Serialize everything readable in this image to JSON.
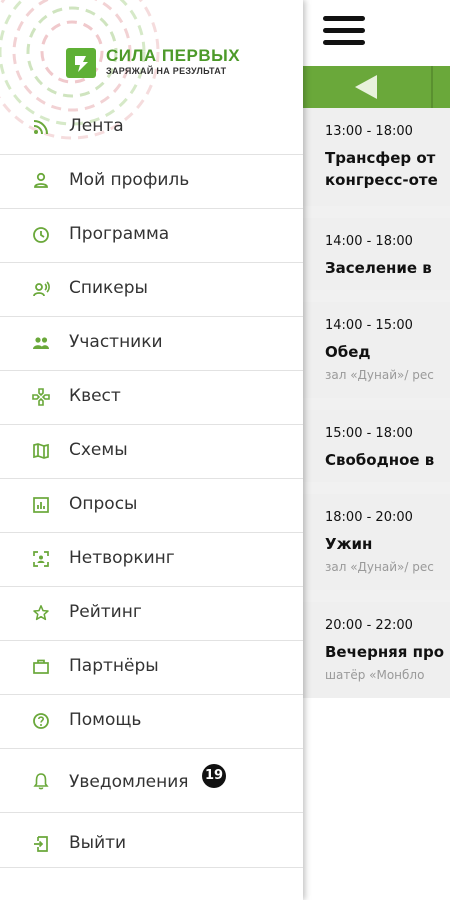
{
  "brand": {
    "title": "СИЛА ПЕРВЫХ",
    "subtitle": "ЗАРЯЖАЙ НА РЕЗУЛЬТАТ",
    "accent": "#6aa83a",
    "icon": "brand-logo-icon"
  },
  "menu": [
    {
      "label": "Лента",
      "icon": "rss-icon"
    },
    {
      "label": "Мой профиль",
      "icon": "person-icon"
    },
    {
      "label": "Программа",
      "icon": "clock-icon"
    },
    {
      "label": "Спикеры",
      "icon": "speaker-icon"
    },
    {
      "label": "Участники",
      "icon": "people-icon"
    },
    {
      "label": "Квест",
      "icon": "gamepad-icon"
    },
    {
      "label": "Схемы",
      "icon": "map-icon"
    },
    {
      "label": "Опросы",
      "icon": "poll-icon"
    },
    {
      "label": "Нетворкинг",
      "icon": "scan-icon"
    },
    {
      "label": "Рейтинг",
      "icon": "star-icon"
    },
    {
      "label": "Партнёры",
      "icon": "briefcase-icon"
    },
    {
      "label": "Помощь",
      "icon": "help-icon"
    },
    {
      "label": "Уведомления",
      "icon": "bell-icon",
      "badge": "19"
    },
    {
      "label": "Выйти",
      "icon": "logout-icon"
    }
  ],
  "schedule": {
    "events": [
      {
        "time": "13:00 - 18:00",
        "title_line1": "Трансфер от",
        "title_line2": "конгресс-оте",
        "place": ""
      },
      {
        "time": "14:00 - 18:00",
        "title_line1": "Заселение в",
        "title_line2": "",
        "place": ""
      },
      {
        "time": "14:00 - 15:00",
        "title_line1": "Обед",
        "title_line2": "",
        "place": "зал «Дунай»/ рес"
      },
      {
        "time": "15:00 - 18:00",
        "title_line1": "Свободное в",
        "title_line2": "",
        "place": ""
      },
      {
        "time": "18:00 - 20:00",
        "title_line1": "Ужин",
        "title_line2": "",
        "place": "зал «Дунай»/ рес"
      },
      {
        "time": "20:00 - 22:00",
        "title_line1": "Вечерняя про",
        "title_line2": "",
        "place": "шатёр «Монбло"
      }
    ]
  }
}
